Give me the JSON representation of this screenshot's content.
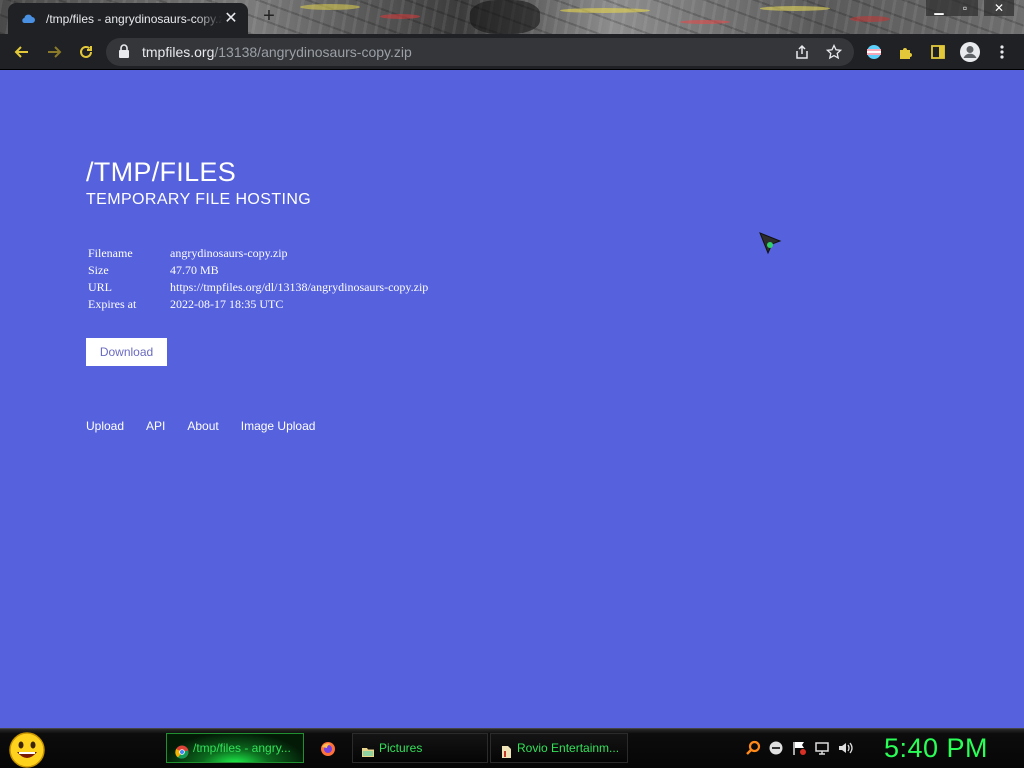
{
  "browser": {
    "tab_title": "/tmp/files - angrydinosaurs-copy.zip",
    "tab_close": "✕",
    "new_tab": "+",
    "window_controls": {
      "minimize": "▁",
      "maximize": "▫",
      "close": "✕"
    },
    "url": {
      "host": "tmpfiles.org",
      "path": "/13138/angrydinosaurs-copy.zip"
    }
  },
  "page": {
    "title": "/TMP/FILES",
    "subtitle": "TEMPORARY FILE HOSTING",
    "file_info": [
      {
        "key": "Filename",
        "value": "angrydinosaurs-copy.zip"
      },
      {
        "key": "Size",
        "value": "47.70 MB"
      },
      {
        "key": "URL",
        "value": "https://tmpfiles.org/dl/13138/angrydinosaurs-copy.zip"
      },
      {
        "key": "Expires at",
        "value": "2022-08-17 18:35 UTC"
      }
    ],
    "download_label": "Download",
    "footer_links": [
      "Upload",
      "API",
      "About",
      "Image Upload"
    ],
    "background_color": "#5561dd"
  },
  "taskbar": {
    "tasks": [
      {
        "label": "/tmp/files - angry...",
        "icon": "chrome-icon",
        "active": true
      },
      {
        "label": "",
        "icon": "firefox-icon",
        "active": false
      },
      {
        "label": "Pictures",
        "icon": "folder-icon",
        "active": false
      },
      {
        "label": "Rovio Entertainm...",
        "icon": "document-icon",
        "active": false
      }
    ],
    "tray_icons": [
      "search-icon",
      "network-icon",
      "action-center-flag-icon",
      "display-icon",
      "volume-icon"
    ],
    "clock": "5:40 PM",
    "clock_color": "#29ff56"
  }
}
